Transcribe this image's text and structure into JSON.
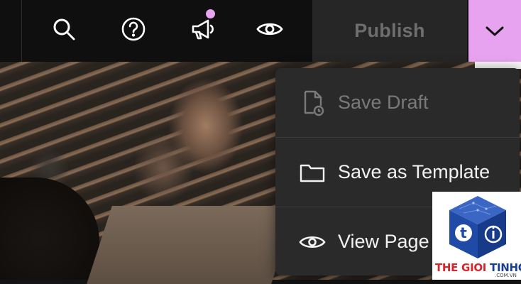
{
  "toolbar": {
    "icons": [
      "search-icon",
      "help-icon",
      "announcements-icon",
      "preview-icon"
    ],
    "notification_dot_color": "#e7a3f0",
    "publish_label": "Publish",
    "publish_bg": "#262626",
    "dropdown_toggle_bg": "#e7a3f0",
    "dropdown_icon": "chevron-down-icon"
  },
  "publish_menu": {
    "items": [
      {
        "label": "Save Draft",
        "icon": "file-clock-icon",
        "enabled": false
      },
      {
        "label": "Save as Template",
        "icon": "folder-icon",
        "enabled": true
      },
      {
        "label": "View Page",
        "icon": "eye-icon",
        "enabled": true
      }
    ]
  },
  "watermark": {
    "brand_red": "THE GIOI ",
    "brand_blue": "TINHOC",
    "domain": ".COM.VN",
    "logo_letter": "t"
  }
}
